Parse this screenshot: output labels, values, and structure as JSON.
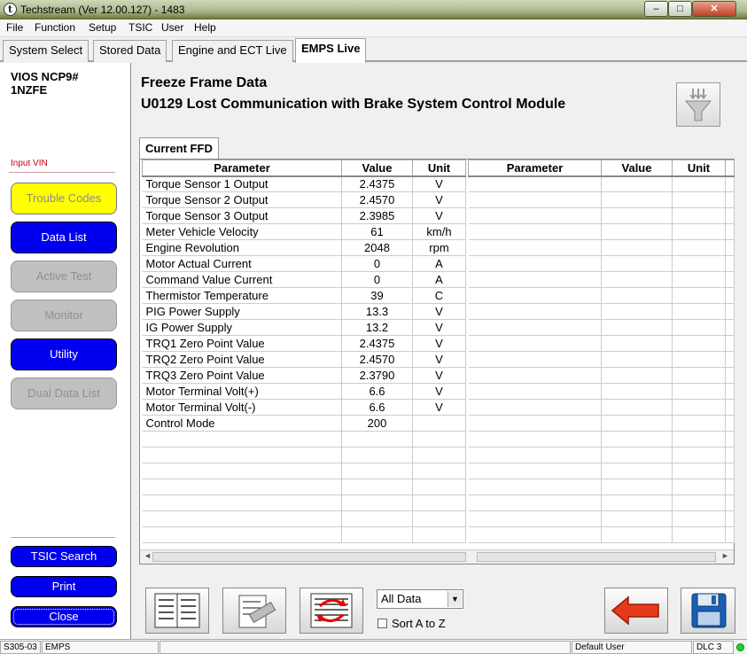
{
  "window": {
    "title": "Techstream (Ver 12.00.127) - 1483",
    "min": "–",
    "max": "□",
    "close": "✕"
  },
  "menu": [
    "File",
    "Function",
    "Setup",
    "TSIC",
    "User",
    "Help"
  ],
  "tabs": [
    {
      "label": "System Select",
      "active": false
    },
    {
      "label": "Stored Data",
      "active": false
    },
    {
      "label": "Engine and ECT Live",
      "active": false
    },
    {
      "label": "EMPS Live",
      "active": true
    }
  ],
  "sidebar": {
    "model": "VIOS NCP9#",
    "engine": "1NZFE",
    "input_vin": "Input VIN",
    "buttons": [
      {
        "label": "Trouble Codes",
        "style": "yellow",
        "enabled": true
      },
      {
        "label": "Data List",
        "style": "blue",
        "enabled": true
      },
      {
        "label": "Active Test",
        "style": "gray",
        "enabled": false
      },
      {
        "label": "Monitor",
        "style": "gray",
        "enabled": false
      },
      {
        "label": "Utility",
        "style": "blue",
        "enabled": true
      },
      {
        "label": "Dual Data List",
        "style": "gray",
        "enabled": false
      }
    ],
    "tsic_search": "TSIC Search",
    "print": "Print",
    "close": "Close"
  },
  "main": {
    "title": "Freeze Frame Data",
    "dtc": "U0129 Lost Communication with Brake System Control Module",
    "ffd_tab": "Current FFD",
    "columns": [
      "Parameter",
      "Value",
      "Unit"
    ],
    "rows": [
      {
        "parameter": "Torque Sensor 1 Output",
        "value": "2.4375",
        "unit": "V"
      },
      {
        "parameter": "Torque Sensor 2 Output",
        "value": "2.4570",
        "unit": "V"
      },
      {
        "parameter": "Torque Sensor 3 Output",
        "value": "2.3985",
        "unit": "V"
      },
      {
        "parameter": "Meter Vehicle Velocity",
        "value": "61",
        "unit": "km/h"
      },
      {
        "parameter": "Engine Revolution",
        "value": "2048",
        "unit": "rpm"
      },
      {
        "parameter": "Motor Actual Current",
        "value": "0",
        "unit": "A"
      },
      {
        "parameter": "Command Value Current",
        "value": "0",
        "unit": "A"
      },
      {
        "parameter": "Thermistor Temperature",
        "value": "39",
        "unit": "C"
      },
      {
        "parameter": "PIG Power Supply",
        "value": "13.3",
        "unit": "V"
      },
      {
        "parameter": "IG Power Supply",
        "value": "13.2",
        "unit": "V"
      },
      {
        "parameter": "TRQ1 Zero Point Value",
        "value": "2.4375",
        "unit": "V"
      },
      {
        "parameter": "TRQ2 Zero Point Value",
        "value": "2.4570",
        "unit": "V"
      },
      {
        "parameter": "TRQ3 Zero Point Value",
        "value": "2.3790",
        "unit": "V"
      },
      {
        "parameter": "Motor Terminal Volt(+)",
        "value": "6.6",
        "unit": "V"
      },
      {
        "parameter": "Motor Terminal Volt(-)",
        "value": "6.6",
        "unit": "V"
      },
      {
        "parameter": "Control Mode",
        "value": "200",
        "unit": ""
      }
    ],
    "empty_rows": 7
  },
  "bottom": {
    "filter_select": "All Data",
    "sort_label": "Sort A to Z",
    "sort_checked": false
  },
  "status": {
    "code": "S305-03",
    "system": "EMPS",
    "user": "Default User",
    "connection": "DLC 3",
    "led_color": "#1fd31f"
  }
}
